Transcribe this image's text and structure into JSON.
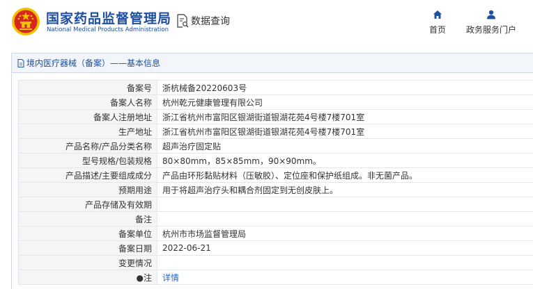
{
  "header": {
    "brand_cn": "国家药品监督管理局",
    "brand_en": "National Medical Products Administration",
    "data_query_label": "数据查询",
    "nav": [
      {
        "label": "首页",
        "icon": "home-icon"
      },
      {
        "label": "政务服务门户",
        "icon": "user-icon"
      }
    ]
  },
  "section": {
    "title": "境内医疗器械（备案）——基本信息"
  },
  "rows": [
    {
      "label": "备案号",
      "value": "浙杭械备20220603号"
    },
    {
      "label": "备案人名称",
      "value": "杭州乾元健康管理有限公司"
    },
    {
      "label": "备案人注册地址",
      "value": "浙江省杭州市富阳区银湖街道银湖花苑4号楼7楼701室"
    },
    {
      "label": "生产地址",
      "value": "浙江省杭州市富阳区银湖街道银湖花苑4号楼7楼701室"
    },
    {
      "label": "产品名称/产品分类名称",
      "value": "超声治疗固定贴"
    },
    {
      "label": "型号规格/包装规格",
      "value": "80×80mm，85×85mm，90×90mm。"
    },
    {
      "label": "产品描述/主要组成成分",
      "value": "产品由环形黏贴材料（压敏胶）、定位座和保护纸组成。非无菌产品。"
    },
    {
      "label": "预期用途",
      "value": "用于将超声治疗头和耦合剂固定到无创皮肤上。"
    },
    {
      "label": "产品存储及有效期",
      "value": ""
    },
    {
      "label": "备注",
      "value": ""
    },
    {
      "label": "备案单位",
      "value": "杭州市市场监督管理局"
    },
    {
      "label": "备案日期",
      "value": "2022-06-21"
    },
    {
      "label": "变更情况",
      "value": ""
    },
    {
      "label": "●注",
      "value": "详情"
    }
  ],
  "colors": {
    "brand_blue": "#1f4fa1",
    "emblem_red": "#d7261e",
    "emblem_gold": "#f2c200",
    "link_blue": "#1f6ac8"
  }
}
